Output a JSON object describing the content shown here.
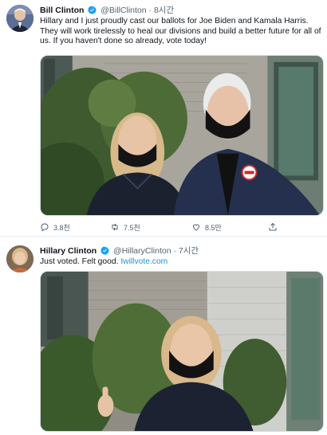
{
  "tweets": [
    {
      "name": "Bill Clinton",
      "handle": "@BillClinton",
      "separator": "·",
      "time": "8시간",
      "text": "Hillary and I just proudly cast our ballots for Joe Biden and Kamala Harris. They will work tirelessly to heal our divisions and build a better future for all of us. If you haven't done so already, vote today!",
      "actions": {
        "reply_count": "3.8천",
        "retweet_count": "7.5천",
        "like_count": "8.5만"
      }
    },
    {
      "name": "Hillary Clinton",
      "handle": "@HillaryClinton",
      "separator": "·",
      "time": "7시간",
      "text": "Just voted. Felt good. ",
      "link": "Iwillvote.com"
    }
  ],
  "colors": {
    "verified": "#1da1f2",
    "link": "#1b95e0",
    "muted": "#536471"
  }
}
